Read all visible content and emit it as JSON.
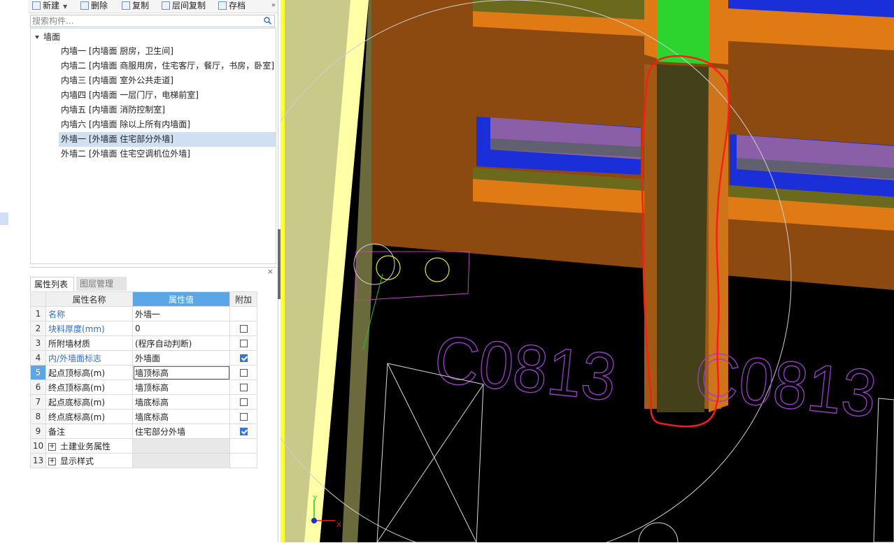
{
  "toolbar": {
    "new_label": "新建",
    "delete_label": "删除",
    "copy_label": "复制",
    "floor_copy_label": "层间复制",
    "save_label": "存档",
    "more": "»"
  },
  "search": {
    "placeholder": "搜索构件..."
  },
  "tree": {
    "root_label": "墙面",
    "items": [
      {
        "label": "内墙一 [内墙面 厨房，卫生间]"
      },
      {
        "label": "内墙二 [内墙面 商服用房，住宅客厅，餐厅，书房，卧室]"
      },
      {
        "label": "内墙三 [内墙面 室外公共走道]"
      },
      {
        "label": "内墙四 [内墙面 一层门厅，电梯前室]"
      },
      {
        "label": "内墙五 [内墙面 消防控制室]"
      },
      {
        "label": "内墙六 [内墙面 除以上所有内墙面]"
      },
      {
        "label": "外墙一 [外墙面 住宅部分外墙]",
        "selected": true
      },
      {
        "label": "外墙二 [外墙面 住宅空调机位外墙]"
      }
    ]
  },
  "properties": {
    "close": "×",
    "tab_list": "属性列表",
    "tab_layers": "图层管理",
    "headers": {
      "name": "属性名称",
      "value": "属性值",
      "extra": "附加"
    },
    "rows": [
      {
        "num": "1",
        "name": "名称",
        "value": "外墙一",
        "blue": true,
        "checkbox": false,
        "checked": false
      },
      {
        "num": "2",
        "name": "块料厚度(mm)",
        "value": "0",
        "blue": true,
        "checkbox": true,
        "checked": false
      },
      {
        "num": "3",
        "name": "所附墙材质",
        "value": "(程序自动判断)",
        "blue": false,
        "checkbox": true,
        "checked": false
      },
      {
        "num": "4",
        "name": "内/外墙面标志",
        "value": "外墙面",
        "blue": true,
        "checkbox": true,
        "checked": true
      },
      {
        "num": "5",
        "name": "起点顶标高(m)",
        "value": "墙顶标高",
        "blue": false,
        "checkbox": true,
        "checked": false,
        "current": true
      },
      {
        "num": "6",
        "name": "终点顶标高(m)",
        "value": "墙顶标高",
        "blue": false,
        "checkbox": true,
        "checked": false
      },
      {
        "num": "7",
        "name": "起点底标高(m)",
        "value": "墙底标高",
        "blue": false,
        "checkbox": true,
        "checked": false
      },
      {
        "num": "8",
        "name": "终点底标高(m)",
        "value": "墙底标高",
        "blue": false,
        "checkbox": true,
        "checked": false
      },
      {
        "num": "9",
        "name": "备注",
        "value": "住宅部分外墙",
        "blue": false,
        "checkbox": true,
        "checked": true
      },
      {
        "num": "10",
        "name": "土建业务属性",
        "value": "",
        "blue": false,
        "checkbox": false,
        "checked": false,
        "group": true
      },
      {
        "num": "13",
        "name": "显示样式",
        "value": "",
        "blue": false,
        "checkbox": false,
        "checked": false,
        "group": true
      }
    ]
  },
  "viewport": {
    "label_1": "C0813",
    "label_2": "C0813",
    "axis_y": "Y",
    "axis_x": "X"
  },
  "colors": {
    "wall_brown": "#8c4a10",
    "slab_orange": "#e07a14",
    "olive": "#6b6a1c",
    "window_blue": "#1a2fd8",
    "green_column": "#2dd42d",
    "selection_red": "#ff1a1a",
    "label_purple": "#9a3fc8",
    "accent_blue": "#5aa6e6"
  }
}
